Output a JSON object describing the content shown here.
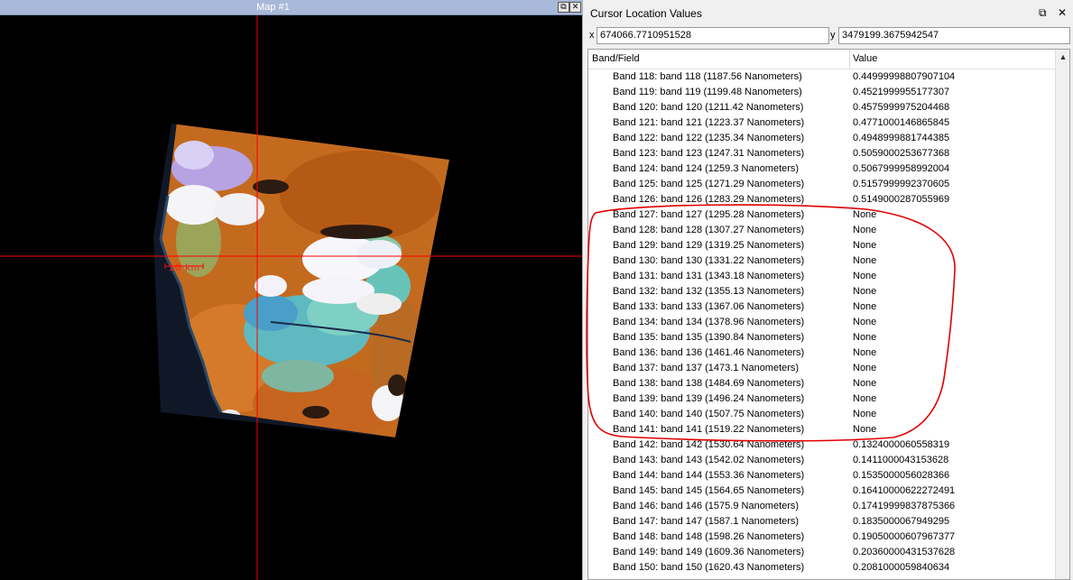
{
  "map": {
    "title": "Map #1",
    "scale_label": "10 km",
    "restore_icon": "restore-icon",
    "close_icon": "close-icon"
  },
  "cursor_panel": {
    "title": "Cursor Location Values",
    "x_label": "x",
    "x_value": "674066.7710951528",
    "y_label": "y",
    "y_value": "3479199.3675942547",
    "col_band": "Band/Field",
    "col_value": "Value",
    "rows": [
      {
        "band": "Band 118: band 118 (1187.56 Nanometers)",
        "value": "0.44999998807907104"
      },
      {
        "band": "Band 119: band 119 (1199.48 Nanometers)",
        "value": "0.4521999955177307"
      },
      {
        "band": "Band 120: band 120 (1211.42 Nanometers)",
        "value": "0.4575999975204468"
      },
      {
        "band": "Band 121: band 121 (1223.37 Nanometers)",
        "value": "0.4771000146865845"
      },
      {
        "band": "Band 122: band 122 (1235.34 Nanometers)",
        "value": "0.4948999881744385"
      },
      {
        "band": "Band 123: band 123 (1247.31 Nanometers)",
        "value": "0.5059000253677368"
      },
      {
        "band": "Band 124: band 124 (1259.3 Nanometers)",
        "value": "0.5067999958992004"
      },
      {
        "band": "Band 125: band 125 (1271.29 Nanometers)",
        "value": "0.5157999992370605"
      },
      {
        "band": "Band 126: band 126 (1283.29 Nanometers)",
        "value": "0.5149000287055969"
      },
      {
        "band": "Band 127: band 127 (1295.28 Nanometers)",
        "value": "None"
      },
      {
        "band": "Band 128: band 128 (1307.27 Nanometers)",
        "value": "None"
      },
      {
        "band": "Band 129: band 129 (1319.25 Nanometers)",
        "value": "None"
      },
      {
        "band": "Band 130: band 130 (1331.22 Nanometers)",
        "value": "None"
      },
      {
        "band": "Band 131: band 131 (1343.18 Nanometers)",
        "value": "None"
      },
      {
        "band": "Band 132: band 132 (1355.13 Nanometers)",
        "value": "None"
      },
      {
        "band": "Band 133: band 133 (1367.06 Nanometers)",
        "value": "None"
      },
      {
        "band": "Band 134: band 134 (1378.96 Nanometers)",
        "value": "None"
      },
      {
        "band": "Band 135: band 135 (1390.84 Nanometers)",
        "value": "None"
      },
      {
        "band": "Band 136: band 136 (1461.46 Nanometers)",
        "value": "None"
      },
      {
        "band": "Band 137: band 137 (1473.1 Nanometers)",
        "value": "None"
      },
      {
        "band": "Band 138: band 138 (1484.69 Nanometers)",
        "value": "None"
      },
      {
        "band": "Band 139: band 139 (1496.24 Nanometers)",
        "value": "None"
      },
      {
        "band": "Band 140: band 140 (1507.75 Nanometers)",
        "value": "None"
      },
      {
        "band": "Band 141: band 141 (1519.22 Nanometers)",
        "value": "None"
      },
      {
        "band": "Band 142: band 142 (1530.64 Nanometers)",
        "value": "0.1324000060558319"
      },
      {
        "band": "Band 143: band 143 (1542.02 Nanometers)",
        "value": "0.1411000043153628"
      },
      {
        "band": "Band 144: band 144 (1553.36 Nanometers)",
        "value": "0.1535000056028366"
      },
      {
        "band": "Band 145: band 145 (1564.65 Nanometers)",
        "value": "0.16410000622272491"
      },
      {
        "band": "Band 146: band 146 (1575.9 Nanometers)",
        "value": "0.17419999837875366"
      },
      {
        "band": "Band 147: band 147 (1587.1 Nanometers)",
        "value": "0.1835000067949295"
      },
      {
        "band": "Band 148: band 148 (1598.26 Nanometers)",
        "value": "0.19050000607967377"
      },
      {
        "band": "Band 149: band 149 (1609.36 Nanometers)",
        "value": "0.20360000431537628"
      },
      {
        "band": "Band 150: band 150 (1620.43 Nanometers)",
        "value": "0.2081000059840634"
      }
    ]
  },
  "colors": {
    "crosshair": "#ff0000",
    "annotation": "#e00000",
    "titlebar": "#a8b8d8"
  }
}
